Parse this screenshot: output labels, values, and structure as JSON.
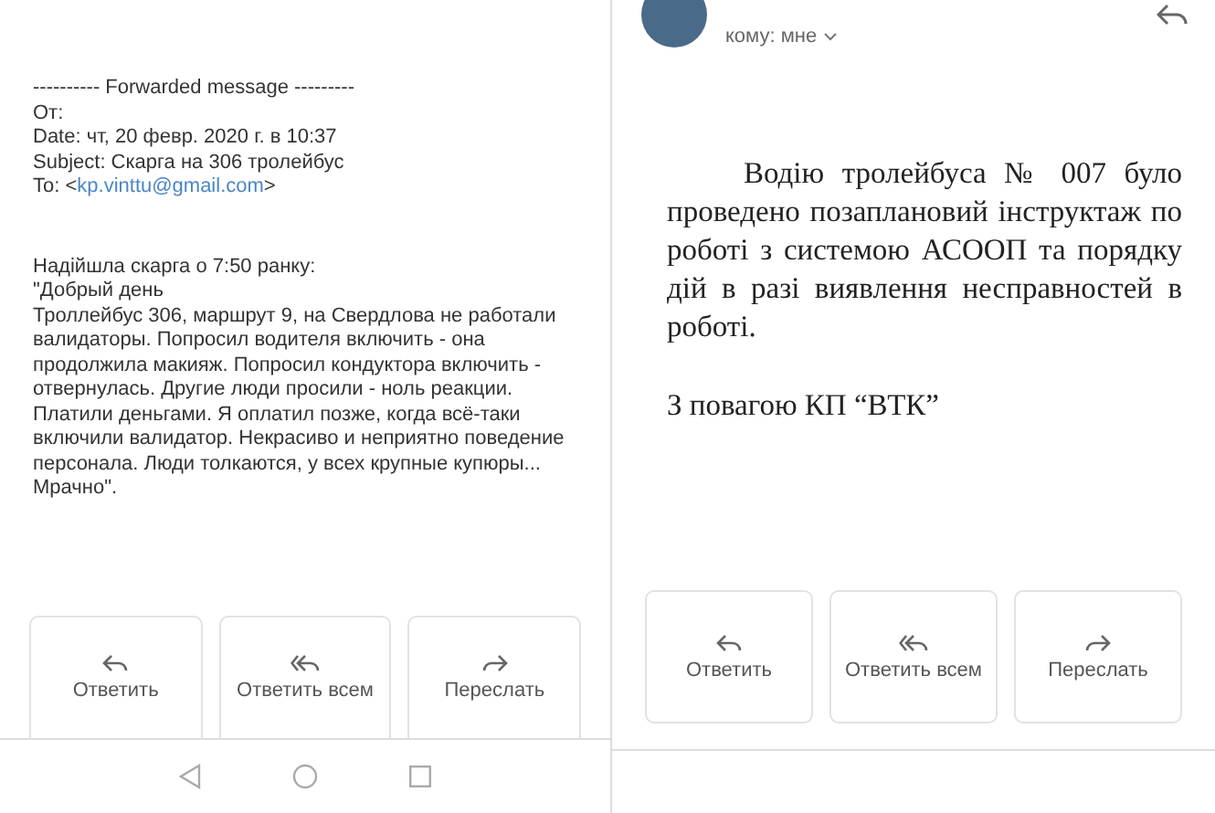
{
  "left_email": {
    "forward_header": [
      {
        "kind": "plain",
        "text": "---------- Forwarded message ---------"
      },
      {
        "kind": "plain",
        "text": "От:"
      },
      {
        "kind": "plain",
        "text": "Date: чт, 20 февр. 2020 г. в 10:37"
      },
      {
        "kind": "plain",
        "text": "Subject: Скарга на 306 тролейбус"
      },
      {
        "kind": "link",
        "prefix": "To: <",
        "link": "kp.vinttu@gmail.com",
        "suffix": ">"
      }
    ],
    "body": [
      "Надійшла скарга о 7:50 ранку:",
      "\"Добрый день",
      "Троллейбус 306, маршрут 9, на Свердлова не работали валидаторы. Попросил водителя включить - она продолжила макияж. Попросил кондуктора включить - отвернулась. Другие люди просили - ноль реакции. Платили деньгами. Я оплатил позже, когда всё-таки включили валидатор. Некрасиво и неприятно поведение персонала. Люди толкаются, у всех крупные купюры... Мрачно\"."
    ],
    "actions": [
      {
        "kind": "reply",
        "label": "Ответить"
      },
      {
        "kind": "reply_all",
        "label": "Ответить всем"
      },
      {
        "kind": "forward",
        "label": "Переслать"
      }
    ]
  },
  "right_email": {
    "recipient": "кому: мне",
    "body": "Водію тролейбуса № 007 було проведено позаплановий інструктаж по роботі з системою АСООП та порядку дій в разі виявлення несправностей в роботі.",
    "signature": "З повагою КП “ВТК”",
    "actions": [
      {
        "kind": "reply",
        "label": "Ответить"
      },
      {
        "kind": "reply_all",
        "label": "Ответить всем"
      },
      {
        "kind": "forward",
        "label": "Переслать"
      }
    ]
  }
}
